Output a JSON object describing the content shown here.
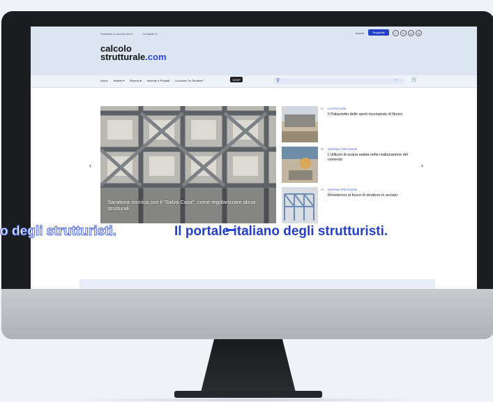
{
  "utility": {
    "left": "Pubblicità su questo sito ▾",
    "right": "Contattaci ▾"
  },
  "logo": {
    "line1": "calcolo",
    "line2a": "strutturale",
    "line2b": ".com"
  },
  "account": {
    "login": "Accedi",
    "register": "Registrati"
  },
  "socials": [
    "f",
    "in",
    "yt",
    "ig"
  ],
  "nav": {
    "items": [
      "Home",
      "Notizie ▾",
      "Ricerca ▾",
      "Aziende e Prodotti",
      "La rivista \"Le Strutture\""
    ],
    "shop": "SHOP",
    "search_icon": "search-icon",
    "cart_icon": "cart-icon"
  },
  "carousel": {
    "caption": "Sanatoria sismica con il \"Salva Casa\": come regolarizzare abusi strutturali",
    "prev_icon": "chevron-left-icon",
    "next_icon": "chevron-right-icon",
    "active_slide": 1,
    "slide_count": 3
  },
  "side_articles": [
    {
      "num": "01",
      "category": "LA STRUTTURA",
      "title": "Il Palazzetto dello sport incompiuto di Nuoro",
      "thumb_colors": [
        "#8c8a84",
        "#c9b99e"
      ]
    },
    {
      "num": "02",
      "category": "MATERIALI PRESTAZIONI",
      "title": "L'utilizzo di acqua salata nella realizzazione del cemento",
      "thumb_colors": [
        "#6f8da6",
        "#c2b6a0"
      ]
    },
    {
      "num": "03",
      "category": "MATERIALI PRESTAZIONI",
      "title": "Resistenza al fuoco di strutture in acciaio",
      "thumb_colors": [
        "#6d8bb4",
        "#d8dde4"
      ]
    }
  ],
  "tagline": {
    "ghost": "ano degli strutturisti.",
    "main": "Il portale italiano degli strutturisti."
  },
  "colors": {
    "accent": "#2340c6",
    "band": "#dde5f3",
    "bezel": "#1c1d20"
  }
}
